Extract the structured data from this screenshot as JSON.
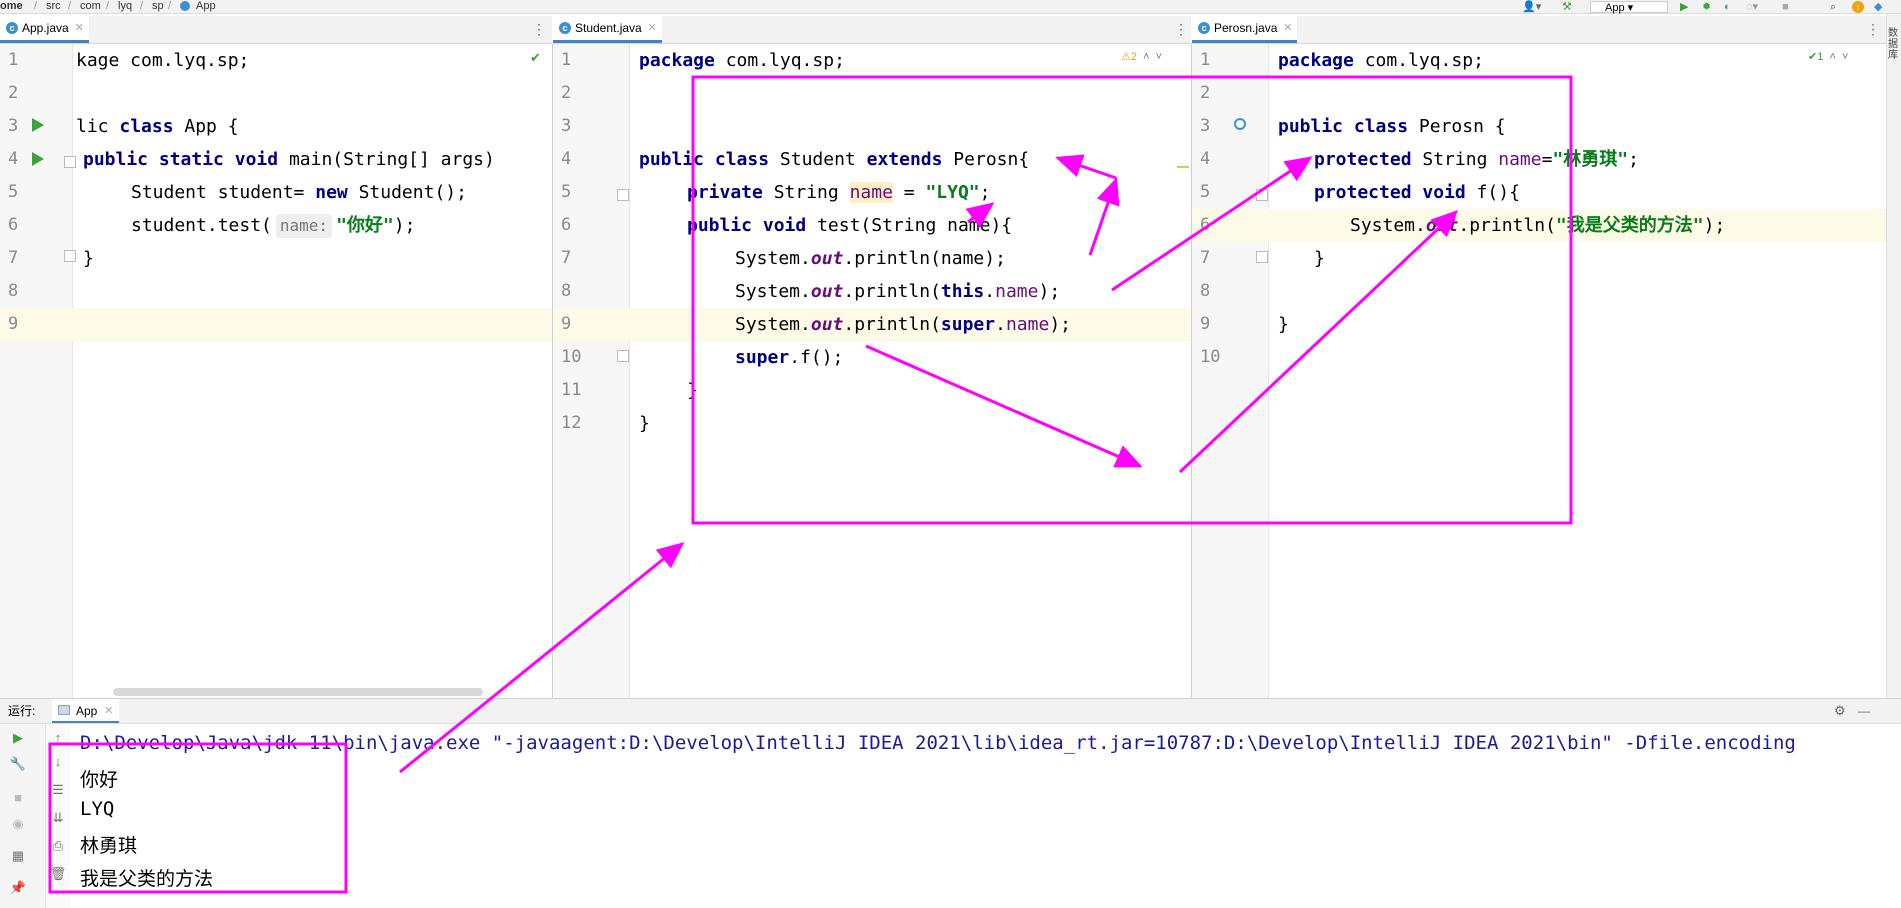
{
  "breadcrumb": [
    "ome",
    "src",
    "com",
    "lyq",
    "sp",
    "App"
  ],
  "run_config": "App",
  "colors": {
    "accent": "#4083c9",
    "annotation": "#ff00ff",
    "keyword": "#000080",
    "string": "#067d17",
    "field": "#660e7a"
  },
  "editors": [
    {
      "tab": "App.java",
      "inspection": "✔",
      "lines": [
        {
          "n": "1",
          "t": "kage com.lyq.sp;"
        },
        {
          "n": "2",
          "t": ""
        },
        {
          "n": "3",
          "t": "lic class App {"
        },
        {
          "n": "4",
          "t": "public static void main(String[] args)"
        },
        {
          "n": "5",
          "t": "Student student= new Student();"
        },
        {
          "n": "6",
          "t": "student.test(",
          "hint": "name:",
          "tail": "\"你好\");"
        },
        {
          "n": "7",
          "t": "}"
        },
        {
          "n": "8",
          "t": ""
        },
        {
          "n": "9",
          "t": ""
        }
      ]
    },
    {
      "tab": "Student.java",
      "inspection": "⚠2",
      "lines": [
        {
          "n": "1",
          "t": "package com.lyq.sp;"
        },
        {
          "n": "2",
          "t": ""
        },
        {
          "n": "3",
          "t": "public class Student extends Perosn{"
        },
        {
          "n": "4",
          "t": "private String name = \"LYQ\";"
        },
        {
          "n": "5",
          "t": "public void test(String name){"
        },
        {
          "n": "6",
          "t": "System.out.println(name);"
        },
        {
          "n": "7",
          "t": "System.out.println(this.name);"
        },
        {
          "n": "8",
          "t": "System.out.println(super.name);"
        },
        {
          "n": "9",
          "t": "super.f();"
        },
        {
          "n": "10",
          "t": "}"
        },
        {
          "n": "11",
          "t": "}"
        },
        {
          "n": "12",
          "t": ""
        }
      ]
    },
    {
      "tab": "Perosn.java",
      "inspection": "✔1",
      "lines": [
        {
          "n": "1",
          "t": "package com.lyq.sp;"
        },
        {
          "n": "2",
          "t": ""
        },
        {
          "n": "3",
          "t": "public class Perosn {"
        },
        {
          "n": "4",
          "t": "protected String name=\"林勇琪\";"
        },
        {
          "n": "5",
          "t": "protected void f(){"
        },
        {
          "n": "6",
          "t": "System.out.println(\"我是父类的方法\");"
        },
        {
          "n": "7",
          "t": "}"
        },
        {
          "n": "8",
          "t": ""
        },
        {
          "n": "9",
          "t": "}"
        },
        {
          "n": "10",
          "t": ""
        }
      ]
    }
  ],
  "run_panel": {
    "label": "运行:",
    "tab": "App",
    "output": [
      "D:\\Develop\\Java\\jdk-11\\bin\\java.exe \"-javaagent:D:\\Develop\\IntelliJ IDEA 2021\\lib\\idea_rt.jar=10787:D:\\Develop\\IntelliJ IDEA 2021\\bin\" -Dfile.encoding",
      "你好",
      "LYQ",
      "林勇琪",
      "我是父类的方法"
    ]
  },
  "right_strip_label": "数据库"
}
